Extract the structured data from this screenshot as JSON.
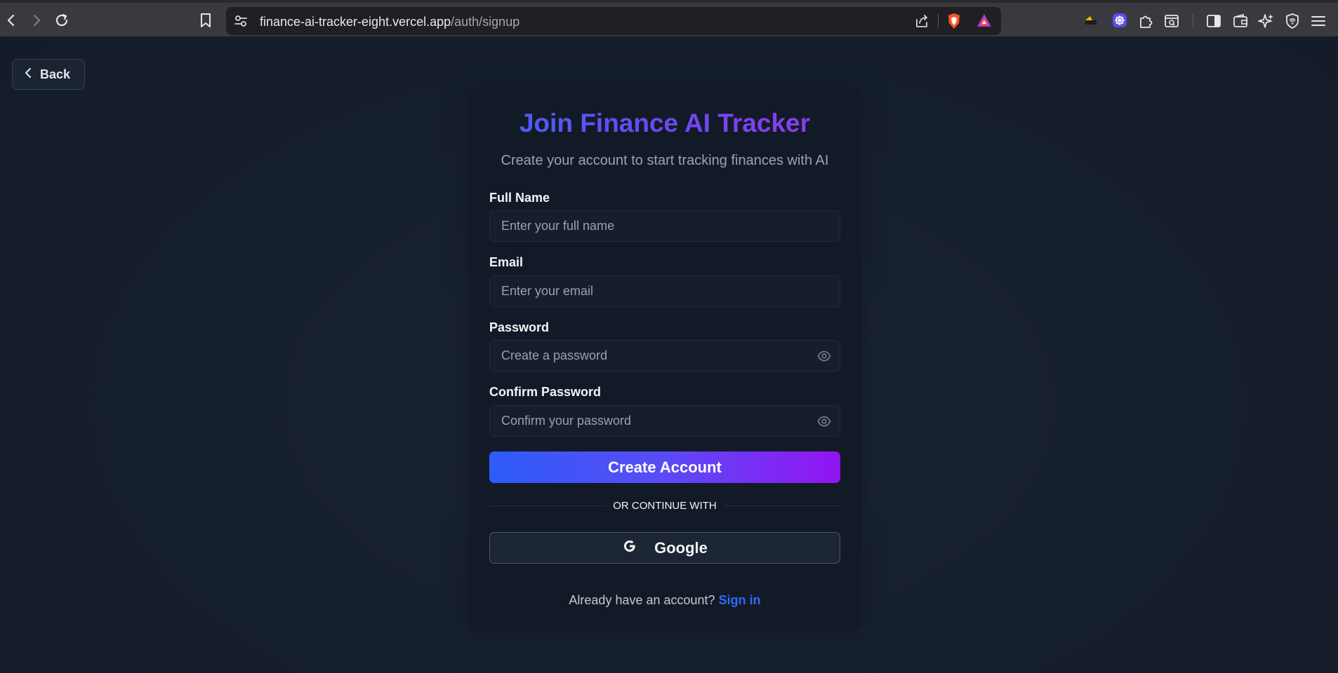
{
  "browser": {
    "url_host": "finance-ai-tracker-eight.vercel.app",
    "url_path": "/auth/signup"
  },
  "back_button": {
    "label": "Back"
  },
  "signup": {
    "title": "Join Finance AI Tracker",
    "subtitle": "Create your account to start tracking finances with AI",
    "fields": {
      "full_name": {
        "label": "Full Name",
        "placeholder": "Enter your full name"
      },
      "email": {
        "label": "Email",
        "placeholder": "Enter your email"
      },
      "password": {
        "label": "Password",
        "placeholder": "Create a password"
      },
      "confirm_password": {
        "label": "Confirm Password",
        "placeholder": "Confirm your password"
      }
    },
    "submit_label": "Create Account",
    "divider_text": "OR CONTINUE WITH",
    "google_label": "Google",
    "signin_prompt": "Already have an account?",
    "signin_link": "Sign in"
  },
  "colors": {
    "accent_start": "#2d5cf8",
    "accent_end": "#9314f2",
    "link": "#2f6bf5",
    "background": "#172030"
  },
  "icons": [
    "back-arrow-icon",
    "forward-arrow-icon",
    "reload-icon",
    "bookmark-icon",
    "site-info-icon",
    "share-icon",
    "brave-shield-icon",
    "brave-rewards-icon",
    "extension-icon",
    "puzzle-icon",
    "reader-icon",
    "sidebar-icon",
    "wallet-icon",
    "leo-ai-icon",
    "vpn-icon",
    "menu-icon",
    "chevron-left-icon",
    "eye-icon",
    "google-icon"
  ]
}
